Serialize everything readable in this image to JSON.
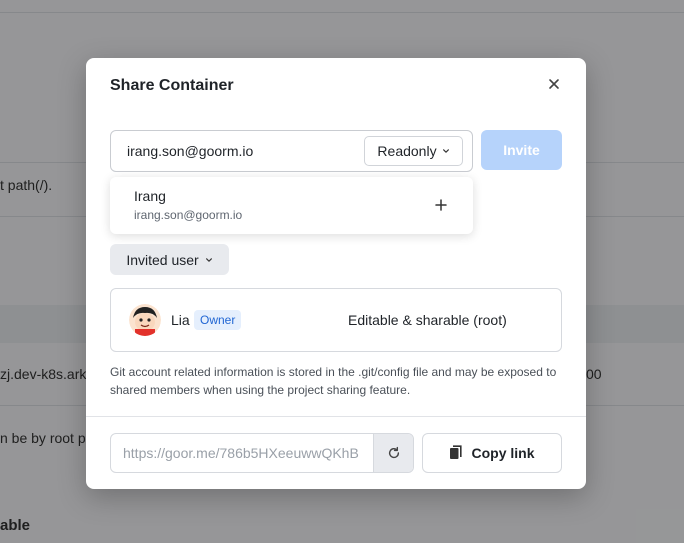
{
  "background": {
    "texts": [
      "t path(/).",
      "zj.dev-k8s.ark",
      "n be by root p",
      "able",
      "t",
      "00"
    ]
  },
  "modal": {
    "title": "Share Container",
    "close_icon": "close-icon",
    "email_value": "irang.son@goorm.io",
    "permission_selected": "Readonly",
    "invite_label": "Invite",
    "suggestion": {
      "name": "Irang",
      "email": "irang.son@goorm.io",
      "add_icon": "plus-icon"
    },
    "invited_toggle_label": "Invited user",
    "users": [
      {
        "name": "Lia",
        "badge": "Owner",
        "permission": "Editable & sharable (root)"
      }
    ],
    "notice": "Git account related information is stored in the .git/config file and may be exposed to shared members when using the project sharing feature.",
    "share_link": "https://goor.me/786b5HXeeuwwQKhB",
    "copy_label": "Copy link"
  },
  "colors": {
    "primary_disabled": "#b6d3fb",
    "badge_text": "#2166d3",
    "badge_bg": "#e5effd"
  }
}
